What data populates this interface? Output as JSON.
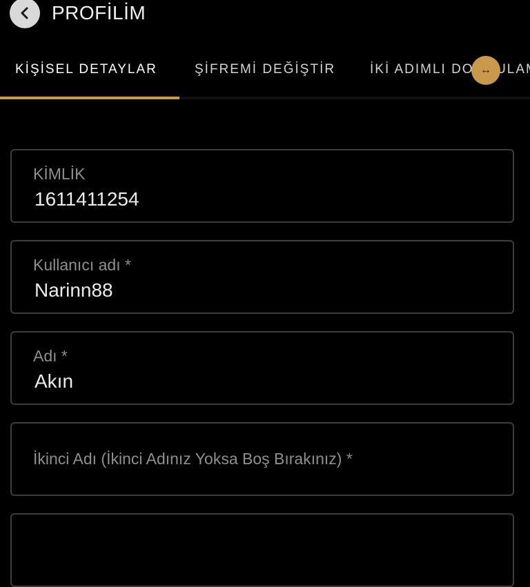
{
  "header": {
    "title": "PROFİLİM",
    "back_icon": "chevron-left-icon"
  },
  "tabs": [
    {
      "label": "KİŞİSEL DETAYLAR",
      "active": true
    },
    {
      "label": "ŞİFREMİ DEĞİŞTİR",
      "active": false
    },
    {
      "label": "İKİ ADIMLI DOĞRULAMA",
      "active": false
    }
  ],
  "scroll_handle": {
    "icon": "horizontal-arrows-icon",
    "glyph": "↔"
  },
  "form": {
    "fields": [
      {
        "label": "KİMLİK",
        "value": "1611411254"
      },
      {
        "label": "Kullanıcı adı *",
        "value": "Narinn88"
      },
      {
        "label": "Adı *",
        "value": "Akın"
      },
      {
        "label": "",
        "value": "",
        "placeholder": "İkinci Adı (İkinci Adınız Yoksa Boş Bırakınız) *"
      }
    ]
  },
  "colors": {
    "background": "#000000",
    "accent": "#c99a4b",
    "field_border": "#3d3d3d",
    "label": "#8f8f8f",
    "text": "#ebebeb"
  }
}
